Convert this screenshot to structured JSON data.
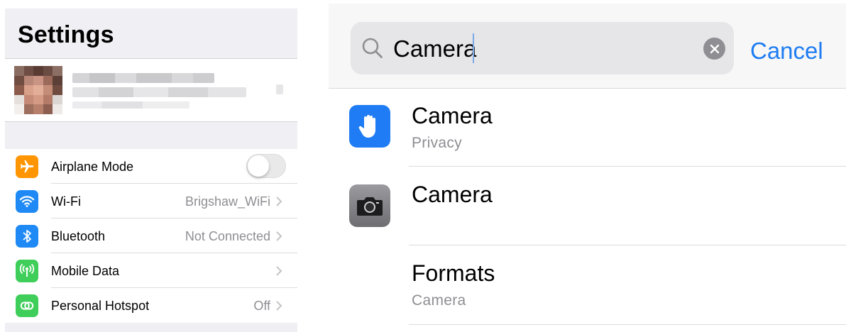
{
  "settings": {
    "title": "Settings",
    "rows": [
      {
        "label": "Airplane Mode",
        "value": "",
        "icon": "airplane-icon",
        "color": "#ff9500",
        "control": "toggle",
        "toggle_on": false
      },
      {
        "label": "Wi-Fi",
        "value": "Brigshaw_WiFi",
        "icon": "wifi-icon",
        "color": "#1f8af5",
        "control": "chevron"
      },
      {
        "label": "Bluetooth",
        "value": "Not Connected",
        "icon": "bluetooth-icon",
        "color": "#1f8af5",
        "control": "chevron"
      },
      {
        "label": "Mobile Data",
        "value": "",
        "icon": "antenna-icon",
        "color": "#3fce5a",
        "control": "chevron"
      },
      {
        "label": "Personal Hotspot",
        "value": "Off",
        "icon": "hotspot-link-icon",
        "color": "#3fce5a",
        "control": "chevron"
      }
    ]
  },
  "search": {
    "query": "Camera",
    "cancel_label": "Cancel",
    "results": [
      {
        "title": "Camera",
        "subtitle": "Privacy",
        "icon": "privacy-hand-icon",
        "color": "#1f7cf4"
      },
      {
        "title": "Camera",
        "subtitle": "",
        "icon": "camera-app-icon",
        "color": "#7d7d82"
      },
      {
        "title": "Formats",
        "subtitle": "Camera",
        "icon": "",
        "color": ""
      }
    ]
  },
  "colors": {
    "accent": "#1d7cf2",
    "secondary_text": "#8e8e93",
    "grouped_background": "#efeff4"
  }
}
